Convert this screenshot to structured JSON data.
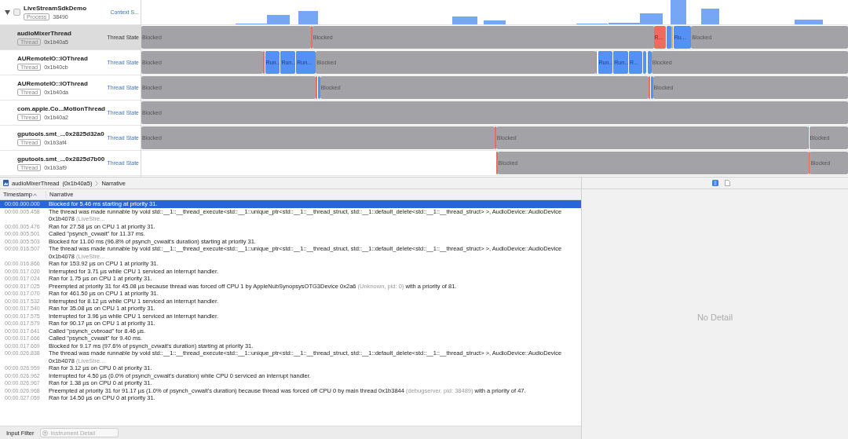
{
  "process": {
    "name": "LiveStreamSdkDemo",
    "badge": "Process",
    "pid": "38490",
    "track_label": "Context S...",
    "expanded": true
  },
  "threads": [
    {
      "name": "audioMixerThread",
      "badge": "Thread",
      "id": "0x1b40a5",
      "track_label": "Thread State",
      "selected": true,
      "segments": [
        {
          "kind": "blocked",
          "label": "Blocked"
        },
        {
          "kind": "runnable"
        },
        {
          "kind": "blocked",
          "label": "Blocked"
        },
        {
          "kind": "runnable",
          "label": "R..."
        },
        {
          "kind": "running"
        },
        {
          "kind": "interrupted"
        },
        {
          "kind": "running",
          "label": "Ru..."
        },
        {
          "kind": "blocked",
          "label": "Blocked"
        }
      ]
    },
    {
      "name": "AURemoteIO::IOThread",
      "badge": "Thread",
      "id": "0x1b40cb",
      "track_label": "Thread State",
      "selected": false,
      "segments": [
        {
          "kind": "blocked",
          "label": "Blocked"
        },
        {
          "kind": "runnable"
        },
        {
          "kind": "running",
          "label": "Run..."
        },
        {
          "kind": "running",
          "label": "Run..."
        },
        {
          "kind": "running",
          "label": "Run..."
        },
        {
          "kind": "blocked",
          "label": "Blocked"
        },
        {
          "kind": "runnable"
        },
        {
          "kind": "running",
          "label": "Run..."
        },
        {
          "kind": "running",
          "label": "Run..."
        },
        {
          "kind": "running",
          "label": "R..."
        },
        {
          "kind": "running"
        },
        {
          "kind": "running"
        },
        {
          "kind": "blocked",
          "label": "Blocked"
        }
      ]
    },
    {
      "name": "AURemoteIO::IOThread",
      "badge": "Thread",
      "id": "0x1b40da",
      "track_label": "Thread State",
      "selected": false,
      "segments": [
        {
          "kind": "blocked",
          "label": "Blocked"
        },
        {
          "kind": "runnable"
        },
        {
          "kind": "running"
        },
        {
          "kind": "blocked",
          "label": "Blocked"
        },
        {
          "kind": "runnable"
        },
        {
          "kind": "running"
        },
        {
          "kind": "blocked",
          "label": "Blocked"
        }
      ]
    },
    {
      "name": "com.apple.Co...MotionThread",
      "badge": "Thread",
      "id": "0x1b40a2",
      "track_label": "Thread State",
      "selected": false,
      "segments": [
        {
          "kind": "blocked",
          "label": "Blocked"
        }
      ]
    },
    {
      "name": "gputools.smt_...0x2825d32a0",
      "badge": "Thread",
      "id": "0x1b3af4",
      "track_label": "Thread State",
      "selected": false,
      "segments": [
        {
          "kind": "blocked",
          "label": "Blocked"
        },
        {
          "kind": "runnable"
        },
        {
          "kind": "blocked",
          "label": "Blocked"
        },
        {
          "kind": "runnable"
        },
        {
          "kind": "blocked",
          "label": "Blocked"
        }
      ]
    },
    {
      "name": "gputools.smt_...0x2825d7b00",
      "badge": "Thread",
      "id": "0x1b3af9",
      "track_label": "Thread State",
      "selected": false,
      "segments": [
        {
          "kind": "none"
        },
        {
          "kind": "runnable"
        },
        {
          "kind": "blocked",
          "label": "Blocked"
        },
        {
          "kind": "runnable"
        },
        {
          "kind": "blocked",
          "label": "Blocked"
        }
      ]
    }
  ],
  "breadcrumb": {
    "thread": "audioMixerThread",
    "id": "(0x1b40a5)",
    "view": "Narrative"
  },
  "table": {
    "columns": [
      {
        "label": "Timestamp",
        "sorted": true
      },
      {
        "label": "Narrative",
        "sorted": false
      }
    ],
    "rows": [
      {
        "time": "00:00.000.000",
        "selected": true,
        "parts": [
          {
            "text": "Blocked for 5.46 ms starting at priority 31."
          }
        ]
      },
      {
        "time": "00:00.005.458",
        "selected": false,
        "parts": [
          {
            "text": "The thread was made runnable by void std::__1::__thread_execute<std::__1::unique_ptr<std::__1::__thread_struct, std::__1::default_delete<std::__1::__thread_struct> >, AudioDevice::AudioDevice  0x1b4078 "
          },
          {
            "text": "(LiveStre...",
            "muted": true
          }
        ]
      },
      {
        "time": "00:00.005.476",
        "selected": false,
        "parts": [
          {
            "text": "Ran for 27.58 µs on CPU 1 at priority 31."
          }
        ]
      },
      {
        "time": "00:00.005.501",
        "selected": false,
        "parts": [
          {
            "text": "Called \"psynch_cvwait\" for 11.37 ms."
          }
        ]
      },
      {
        "time": "00:00.005.503",
        "selected": false,
        "parts": [
          {
            "text": "Blocked for 11.00 ms (96.8% of psynch_cvwait's duration) starting at priority 31."
          }
        ]
      },
      {
        "time": "00:00.016.507",
        "selected": false,
        "parts": [
          {
            "text": "The thread was made runnable by void std::__1::__thread_execute<std::__1::unique_ptr<std::__1::__thread_struct, std::__1::default_delete<std::__1::__thread_struct> >, AudioDevice::AudioDevice  0x1b4078 "
          },
          {
            "text": "(LiveStre...",
            "muted": true
          }
        ]
      },
      {
        "time": "00:00.016.866",
        "selected": false,
        "parts": [
          {
            "text": "Ran for 153.92 µs on CPU 1 at priority 31."
          }
        ]
      },
      {
        "time": "00:00.017.020",
        "selected": false,
        "parts": [
          {
            "text": "Interrupted for 3.71 µs while CPU 1 serviced an interrupt handler."
          }
        ]
      },
      {
        "time": "00:00.017.024",
        "selected": false,
        "parts": [
          {
            "text": "Ran for 1.75 µs on CPU 1 at priority 31."
          }
        ]
      },
      {
        "time": "00:00.017.025",
        "selected": false,
        "parts": [
          {
            "text": "Preempted at priority 31 for 45.08 µs because thread was forced off CPU 1 by AppleNubSynopsysOTG3Device  0x2a6 "
          },
          {
            "text": "(Unknown, pid: 0)",
            "muted": true
          },
          {
            "text": " with a priority of 81."
          }
        ]
      },
      {
        "time": "00:00.017.070",
        "selected": false,
        "parts": [
          {
            "text": "Ran for 461.50 µs on CPU 1 at priority 31."
          }
        ]
      },
      {
        "time": "00:00.017.532",
        "selected": false,
        "parts": [
          {
            "text": "Interrupted for 8.12 µs while CPU 1 serviced an interrupt handler."
          }
        ]
      },
      {
        "time": "00:00.017.540",
        "selected": false,
        "parts": [
          {
            "text": "Ran for 35.08 µs on CPU 1 at priority 31."
          }
        ]
      },
      {
        "time": "00:00.017.575",
        "selected": false,
        "parts": [
          {
            "text": "Interrupted for 3.96 µs while CPU 1 serviced an interrupt handler."
          }
        ]
      },
      {
        "time": "00:00.017.579",
        "selected": false,
        "parts": [
          {
            "text": "Ran for 90.17 µs on CPU 1 at priority 31."
          }
        ]
      },
      {
        "time": "00:00.017.641",
        "selected": false,
        "parts": [
          {
            "text": "Called \"psynch_cvbroad\" for 8.46 µs."
          }
        ]
      },
      {
        "time": "00:00.017.666",
        "selected": false,
        "parts": [
          {
            "text": "Called \"psynch_cvwait\" for 9.40 ms."
          }
        ]
      },
      {
        "time": "00:00.017.669",
        "selected": false,
        "parts": [
          {
            "text": "Blocked for 9.17 ms (97.6% of psynch_cvwait's duration) starting at priority 31."
          }
        ]
      },
      {
        "time": "00:00.026.838",
        "selected": false,
        "parts": [
          {
            "text": "The thread was made runnable by void std::__1::__thread_execute<std::__1::unique_ptr<std::__1::__thread_struct, std::__1::default_delete<std::__1::__thread_struct> >, AudioDevice::AudioDevice  0x1b4078 "
          },
          {
            "text": "(LiveStre...",
            "muted": true
          }
        ]
      },
      {
        "time": "00:00.026.959",
        "selected": false,
        "parts": [
          {
            "text": "Ran for 3.12 µs on CPU 0 at priority 31."
          }
        ]
      },
      {
        "time": "00:00.026.962",
        "selected": false,
        "parts": [
          {
            "text": "Interrupted for 4.50 µs (0.0% of psynch_cvwait's duration) while CPU 0 serviced an interrupt handler."
          }
        ]
      },
      {
        "time": "00:00.026.967",
        "selected": false,
        "parts": [
          {
            "text": "Ran for 1.38 µs on CPU 0 at priority 31."
          }
        ]
      },
      {
        "time": "00:00.026.968",
        "selected": false,
        "parts": [
          {
            "text": "Preempted at priority 31 for 91.17 µs (1.0% of psynch_cvwait's duration) because thread was forced off CPU 0 by main thread  0x1b3844 "
          },
          {
            "text": "(debugserver, pid: 38489)",
            "muted": true
          },
          {
            "text": " with a priority of 47."
          }
        ]
      },
      {
        "time": "00:00.027.059",
        "selected": false,
        "parts": [
          {
            "text": "Ran for 14.50 µs on CPU 0 at priority 31."
          }
        ]
      }
    ]
  },
  "detail": {
    "message": "No Detail"
  },
  "filter_bar": {
    "label": "Input Filter",
    "placeholder": "Instrument Detail"
  }
}
